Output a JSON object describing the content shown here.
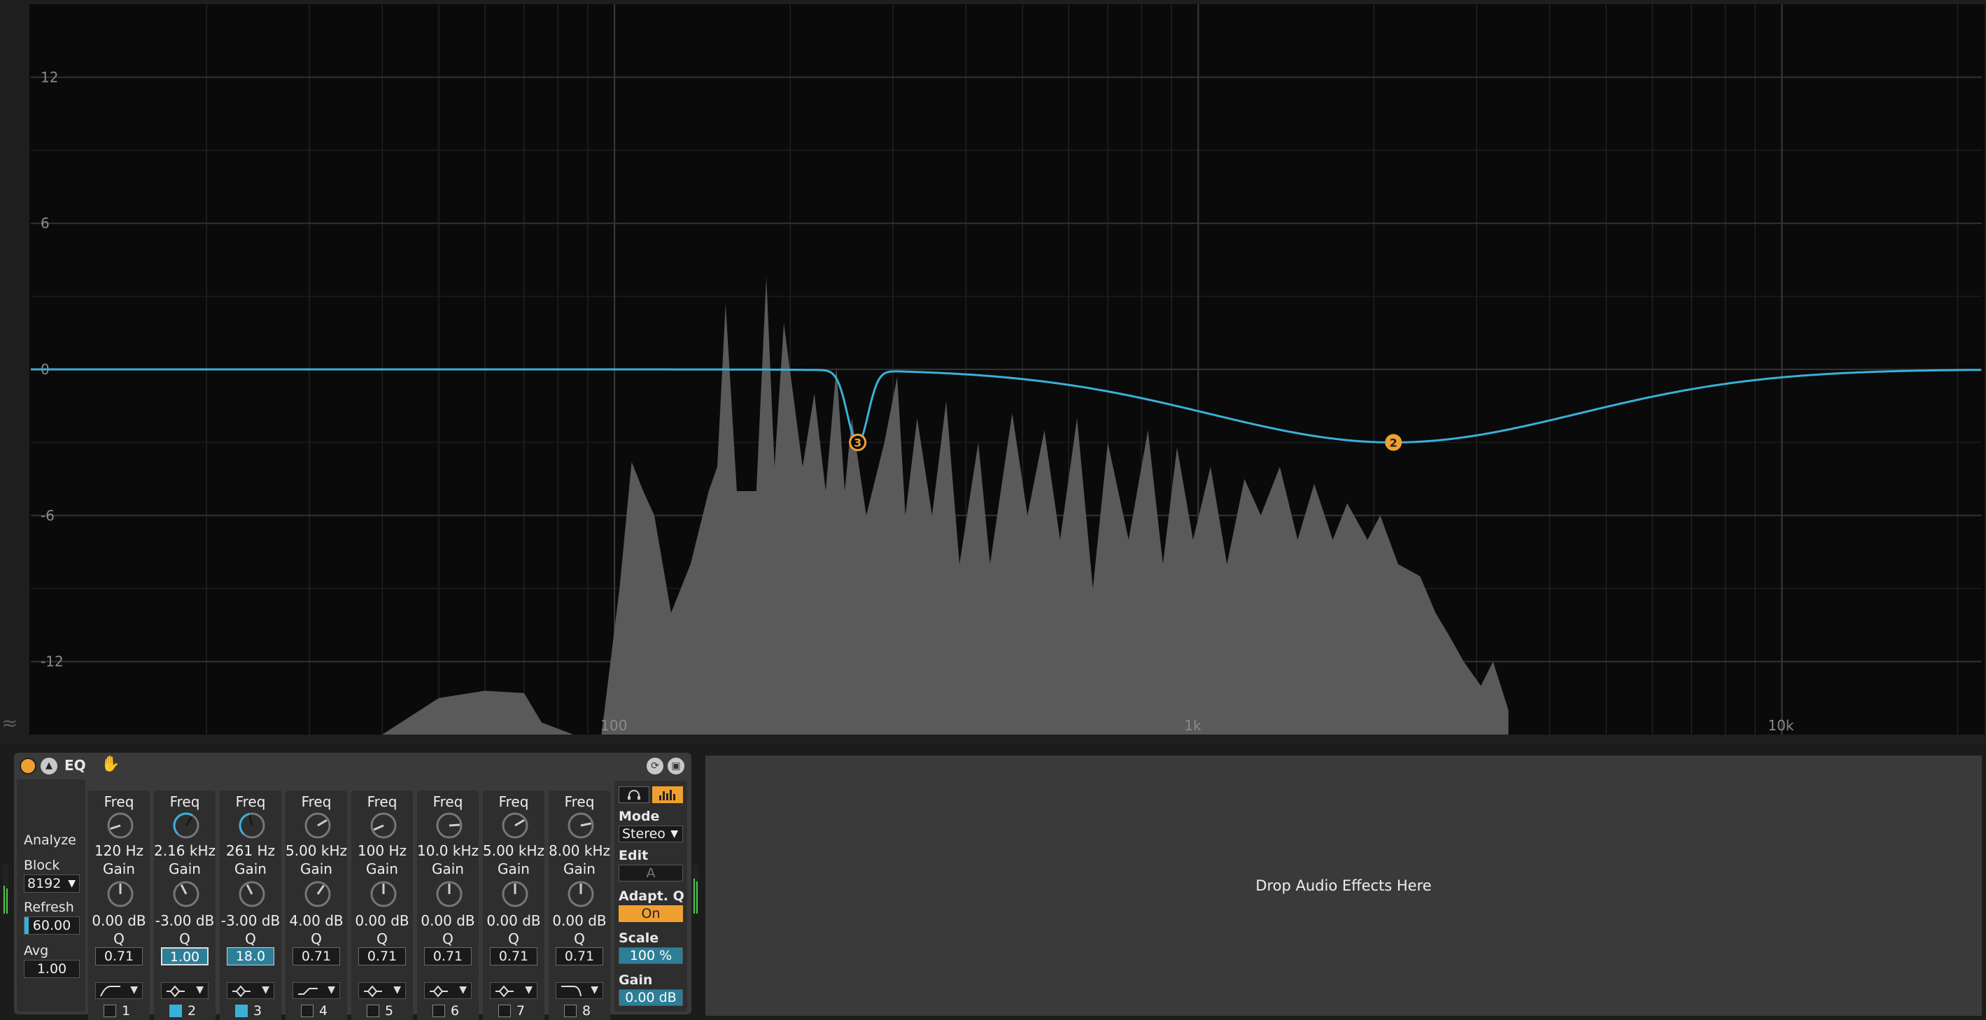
{
  "spectrum": {
    "db_labels": [
      "12",
      "6",
      "0",
      "-6",
      "-12"
    ],
    "db_values": [
      12,
      6,
      0,
      -6,
      -12
    ],
    "freq_labels": [
      "100",
      "1k",
      "10k"
    ],
    "freq_values": [
      100,
      1000,
      10000
    ],
    "freq_range_hz": [
      10,
      22000
    ],
    "db_range": [
      -15,
      15
    ],
    "curve_color": "#3ab0d8",
    "node_color": "#f0a030",
    "nodes": [
      {
        "label": "3",
        "freq_hz": 261,
        "gain_db": -3.0,
        "q": 18.0
      },
      {
        "label": "2",
        "freq_hz": 2160,
        "gain_db": -3.0,
        "q": 1.0
      }
    ],
    "analyzer_peaks": [
      [
        20,
        -25
      ],
      [
        40,
        -15
      ],
      [
        50,
        -13.5
      ],
      [
        60,
        -13.2
      ],
      [
        70,
        -13.3
      ],
      [
        75,
        -14.5
      ],
      [
        85,
        -15
      ],
      [
        95,
        -18
      ],
      [
        102,
        -9
      ],
      [
        107,
        -3.8
      ],
      [
        112,
        -5
      ],
      [
        117,
        -6
      ],
      [
        125,
        -10
      ],
      [
        135,
        -8
      ],
      [
        145,
        -5
      ],
      [
        150,
        -4
      ],
      [
        155,
        2.7
      ],
      [
        162,
        -5
      ],
      [
        175,
        -5
      ],
      [
        182,
        3.8
      ],
      [
        188,
        -4
      ],
      [
        195,
        1.9
      ],
      [
        210,
        -4
      ],
      [
        220,
        -1
      ],
      [
        230,
        -5
      ],
      [
        240,
        0.1
      ],
      [
        248,
        -5
      ],
      [
        255,
        -2
      ],
      [
        270,
        -6
      ],
      [
        290,
        -3
      ],
      [
        305,
        -0.3
      ],
      [
        315,
        -6
      ],
      [
        330,
        -2
      ],
      [
        350,
        -6
      ],
      [
        370,
        -1.3
      ],
      [
        390,
        -8
      ],
      [
        420,
        -3
      ],
      [
        440,
        -8
      ],
      [
        480,
        -1.8
      ],
      [
        510,
        -6
      ],
      [
        545,
        -2.5
      ],
      [
        580,
        -7
      ],
      [
        620,
        -2
      ],
      [
        660,
        -9
      ],
      [
        700,
        -3
      ],
      [
        760,
        -7
      ],
      [
        820,
        -2.5
      ],
      [
        870,
        -8
      ],
      [
        920,
        -3.2
      ],
      [
        980,
        -7
      ],
      [
        1050,
        -4
      ],
      [
        1120,
        -8
      ],
      [
        1200,
        -4.5
      ],
      [
        1280,
        -6
      ],
      [
        1380,
        -4
      ],
      [
        1480,
        -7
      ],
      [
        1580,
        -4.7
      ],
      [
        1700,
        -7
      ],
      [
        1800,
        -5.5
      ],
      [
        1950,
        -7
      ],
      [
        2050,
        -6
      ],
      [
        2200,
        -8
      ],
      [
        2400,
        -8.5
      ],
      [
        2550,
        -10
      ],
      [
        2700,
        -11
      ],
      [
        2850,
        -12
      ],
      [
        3050,
        -13
      ],
      [
        3200,
        -12
      ],
      [
        3400,
        -14
      ]
    ]
  },
  "device": {
    "title": "EQ",
    "left_panel": {
      "analyze_label": "Analyze",
      "block_label": "Block",
      "block_value": "8192",
      "refresh_label": "Refresh",
      "refresh_value": "60.00",
      "avg_label": "Avg",
      "avg_value": "1.00"
    },
    "bands": [
      {
        "number": "1",
        "freq_label": "Freq",
        "freq": "120 Hz",
        "gain_label": "Gain",
        "gain": "0.00 dB",
        "q_label": "Q",
        "q": "0.71",
        "filter": "lowcut",
        "enabled": false,
        "freq_frac": 0.1,
        "gain_frac": 0.5
      },
      {
        "number": "2",
        "freq_label": "Freq",
        "freq": "2.16 kHz",
        "gain_label": "Gain",
        "gain": "-3.00 dB",
        "q_label": "Q",
        "q": "1.00",
        "filter": "bell",
        "enabled": true,
        "freq_frac": 0.62,
        "gain_frac": 0.4
      },
      {
        "number": "3",
        "freq_label": "Freq",
        "freq": "261 Hz",
        "gain_label": "Gain",
        "gain": "-3.00 dB",
        "q_label": "Q",
        "q": "18.0",
        "filter": "bell",
        "enabled": true,
        "freq_frac": 0.45,
        "gain_frac": 0.4
      },
      {
        "number": "4",
        "freq_label": "Freq",
        "freq": "5.00 kHz",
        "gain_label": "Gain",
        "gain": "4.00 dB",
        "q_label": "Q",
        "q": "0.71",
        "filter": "lowshelf",
        "enabled": false,
        "freq_frac": 0.72,
        "gain_frac": 0.63
      },
      {
        "number": "5",
        "freq_label": "Freq",
        "freq": "100 Hz",
        "gain_label": "Gain",
        "gain": "0.00 dB",
        "q_label": "Q",
        "q": "0.71",
        "filter": "bell",
        "enabled": false,
        "freq_frac": 0.08,
        "gain_frac": 0.5
      },
      {
        "number": "6",
        "freq_label": "Freq",
        "freq": "10.0 kHz",
        "gain_label": "Gain",
        "gain": "0.00 dB",
        "q_label": "Q",
        "q": "0.71",
        "filter": "bell",
        "enabled": false,
        "freq_frac": 0.82,
        "gain_frac": 0.5
      },
      {
        "number": "7",
        "freq_label": "Freq",
        "freq": "5.00 kHz",
        "gain_label": "Gain",
        "gain": "0.00 dB",
        "q_label": "Q",
        "q": "0.71",
        "filter": "bell",
        "enabled": false,
        "freq_frac": 0.72,
        "gain_frac": 0.5
      },
      {
        "number": "8",
        "freq_label": "Freq",
        "freq": "8.00 kHz",
        "gain_label": "Gain",
        "gain": "0.00 dB",
        "q_label": "Q",
        "q": "0.71",
        "filter": "highcut",
        "enabled": false,
        "freq_frac": 0.79,
        "gain_frac": 0.5
      }
    ],
    "right_panel": {
      "mode_label": "Mode",
      "mode_value": "Stereo",
      "edit_label": "Edit",
      "edit_value": "A",
      "adaptq_label": "Adapt. Q",
      "adaptq_value": "On",
      "scale_label": "Scale",
      "scale_value": "100 %",
      "gain_label": "Gain",
      "gain_value": "0.00 dB"
    },
    "accent": "#f0a030",
    "select_color": "#3ab0d8"
  },
  "drop_zone": {
    "label": "Drop Audio Effects Here"
  }
}
